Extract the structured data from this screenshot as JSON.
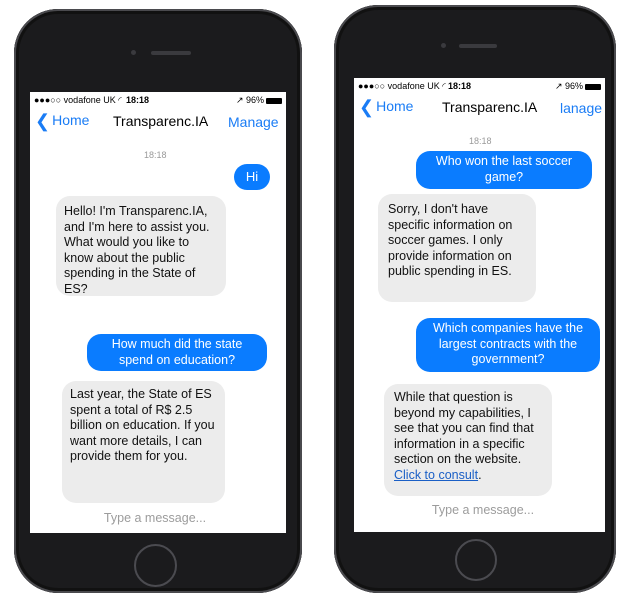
{
  "phones": [
    {
      "status": {
        "carrier": "●●●○○ vodafone UK ◜",
        "time": "18:18",
        "battery": "↗ 96%"
      },
      "nav": {
        "back_label": "Home",
        "title": "Transparenc.IA",
        "action_label": "Manage"
      },
      "timestamp": "18:18",
      "messages": [
        {
          "sender": "user",
          "text": "Hi"
        },
        {
          "sender": "bot",
          "text": "Hello! I'm Transparenc.IA, and I'm here to assist you. What would you like to know about the public spending in the State of ES?"
        },
        {
          "sender": "user",
          "text": "How much did the state spend on education?"
        },
        {
          "sender": "bot",
          "text": "Last year, the State of ES spent a total of R$ 2.5 billion on education. If you want more details, I can provide them for you."
        }
      ],
      "input_placeholder": "Type a message..."
    },
    {
      "status": {
        "carrier": "●●●○○ vodafone UK ◜",
        "time": "18:18",
        "battery": "↗ 96%"
      },
      "nav": {
        "back_label": "Home",
        "title": "Transparenc.IA",
        "action_label": "lanage"
      },
      "timestamp": "18:18",
      "messages": [
        {
          "sender": "user",
          "text": "Who won the last soccer game?"
        },
        {
          "sender": "bot",
          "text": "Sorry, I don't have specific information on soccer games. I only provide information on public spending in ES."
        },
        {
          "sender": "user",
          "text": "Which companies have the largest contracts with the government?"
        },
        {
          "sender": "bot",
          "text": "While that question is beyond my capabilities, I see that you can find that information in a specific section on the website.",
          "link_text": "Click to consult",
          "link_suffix": "."
        }
      ],
      "input_placeholder": "Type a message..."
    }
  ]
}
